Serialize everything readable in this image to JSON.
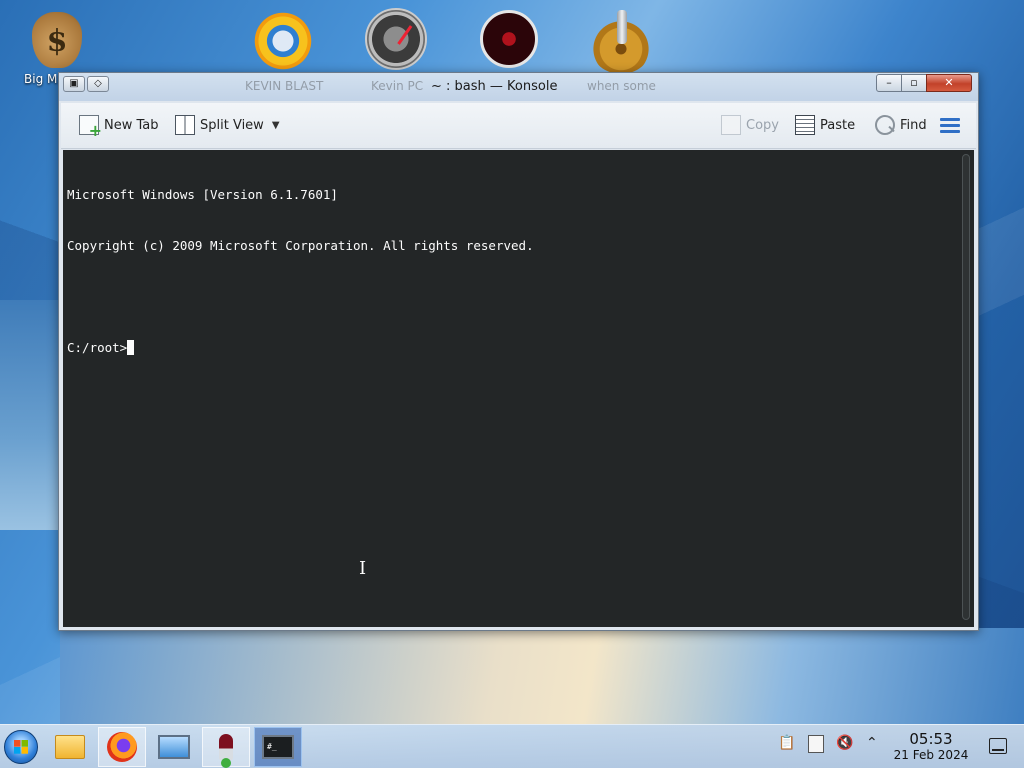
{
  "desktop": {
    "icons": [
      {
        "label": "Big M... Del..."
      },
      {
        "label": "KEVIN BLAST"
      },
      {
        "label": "Kevin PC"
      },
      {
        "label": ""
      },
      {
        "label": "when some"
      }
    ],
    "money_symbol": "$"
  },
  "window": {
    "title": "~ : bash — Konsole",
    "ghost_labels": [
      "KEVIN BLAST",
      "Kevin PC",
      "when some"
    ],
    "controls": {
      "minimize": "–",
      "maximize": "▫",
      "close": "✕"
    }
  },
  "toolbar": {
    "new_tab": "New Tab",
    "split_view": "Split View",
    "copy": "Copy",
    "paste": "Paste",
    "find": "Find"
  },
  "terminal": {
    "lines": [
      "Microsoft Windows [Version 6.1.7601]",
      "Copyright (c) 2009 Microsoft Corporation. All rights reserved.",
      ""
    ],
    "prompt": "C:/root>"
  },
  "taskbar": {
    "apps": [
      "file-manager",
      "firefox",
      "system-monitor",
      "wine",
      "konsole"
    ],
    "terminal_icon_text": "#_",
    "clock_time": "05:53",
    "clock_date": "21 Feb 2024"
  }
}
